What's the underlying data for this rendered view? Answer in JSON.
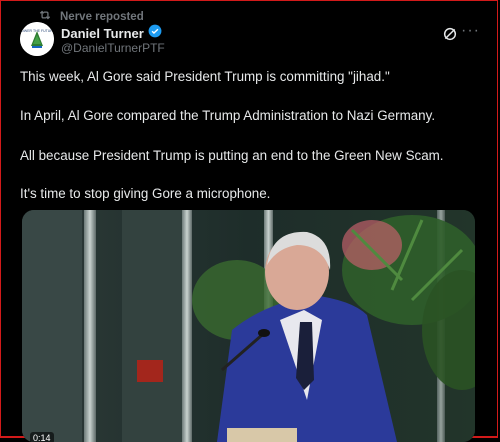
{
  "repost": {
    "label": "Nerve reposted",
    "icon": "repost-icon"
  },
  "author": {
    "name": "Daniel Turner",
    "handle": "@DanielTurnerPTF",
    "verified": true
  },
  "actions": {
    "grok": "grok-icon",
    "more": "···"
  },
  "tweet": {
    "lines": [
      "This week, Al Gore said President Trump is committing \"jihad.\"",
      "In April, Al Gore compared the Trump Administration to Nazi Germany.",
      "All because President Trump is putting an end to the Green New Scam.",
      "It's time to stop giving Gore a microphone."
    ]
  },
  "media": {
    "type": "video",
    "timestamp": "0:14"
  },
  "colors": {
    "background": "#000000",
    "text": "#e7e9ea",
    "muted": "#71767b",
    "verified": "#1d9bf0",
    "frame": "#d21a1a"
  }
}
